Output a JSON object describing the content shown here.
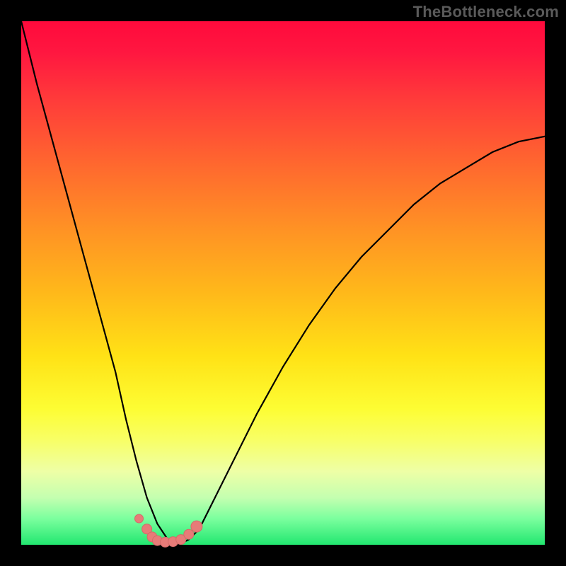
{
  "watermark": "TheBottleneck.com",
  "colors": {
    "background": "#000000",
    "gradient_top": "#ff0a3c",
    "gradient_bottom": "#22e770",
    "curve": "#000000",
    "dots": "#e77b78"
  },
  "chart_data": {
    "type": "line",
    "title": "",
    "xlabel": "",
    "ylabel": "",
    "xlim": [
      0,
      100
    ],
    "ylim": [
      0,
      100
    ],
    "notes": "Axes are unlabeled; values are relative percentages of the plotting area. The curve is a V-shaped bottleneck profile with a flat minimum near x≈25–30; y≈0 at the trough and y≈100 at x≈0. A cluster of salmon-colored points sits along the trough.",
    "series": [
      {
        "name": "bottleneck-curve",
        "x": [
          0,
          3,
          6,
          9,
          12,
          15,
          18,
          20,
          22,
          24,
          26,
          28,
          30,
          32,
          34,
          36,
          40,
          45,
          50,
          55,
          60,
          65,
          70,
          75,
          80,
          85,
          90,
          95,
          100
        ],
        "y": [
          100,
          88,
          77,
          66,
          55,
          44,
          33,
          24,
          16,
          9,
          4,
          1,
          0,
          1,
          3,
          7,
          15,
          25,
          34,
          42,
          49,
          55,
          60,
          65,
          69,
          72,
          75,
          77,
          78
        ]
      }
    ],
    "points": {
      "name": "trough-dots",
      "x": [
        22.5,
        24.0,
        25.0,
        26.0,
        27.5,
        29.0,
        30.5,
        32.0,
        33.5
      ],
      "y": [
        5.0,
        3.0,
        1.5,
        0.8,
        0.5,
        0.6,
        1.0,
        2.0,
        3.5
      ],
      "r": [
        6,
        7,
        7,
        7,
        7,
        7,
        7,
        7,
        8
      ]
    }
  }
}
